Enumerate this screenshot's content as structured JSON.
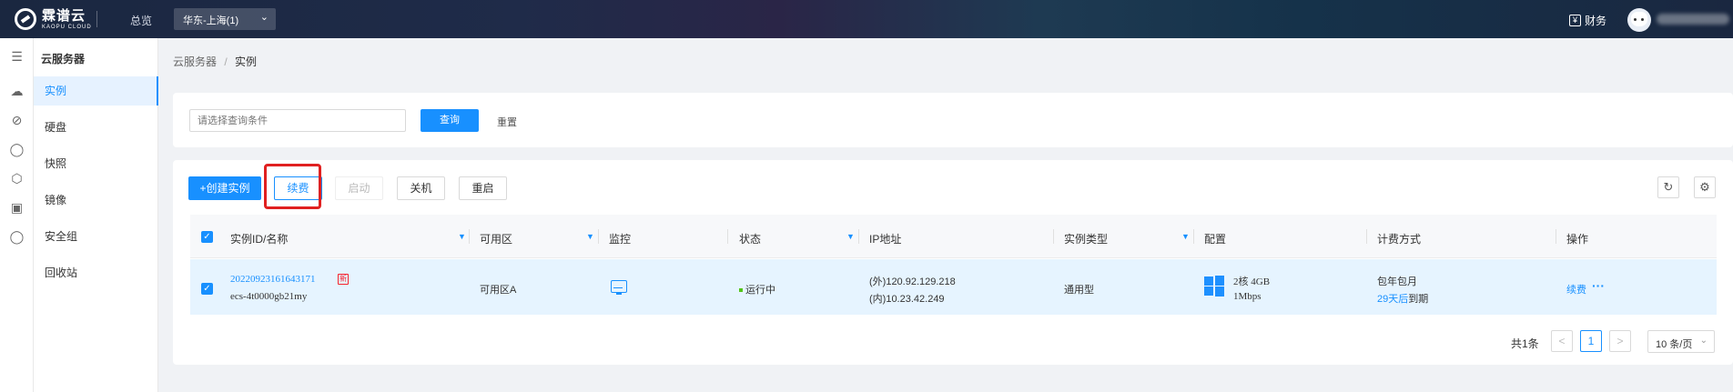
{
  "topbar": {
    "logo_cn": "霖谱云",
    "logo_en": "KAOPU CLOUD",
    "overview": "总览",
    "region": "华东-上海(1)",
    "finance": "财务",
    "yen": "¥"
  },
  "sidebar": {
    "title": "云服务器",
    "items": [
      {
        "label": "实例",
        "active": true
      },
      {
        "label": "硬盘"
      },
      {
        "label": "快照"
      },
      {
        "label": "镜像"
      },
      {
        "label": "安全组"
      },
      {
        "label": "回收站"
      }
    ]
  },
  "breadcrumb": {
    "parent": "云服务器",
    "sep": "/",
    "current": "实例"
  },
  "search": {
    "placeholder": "请选择查询条件",
    "query_button": "查询",
    "reset_button": "重置"
  },
  "toolbar": {
    "create": "+创建实例",
    "renew": "续费",
    "start": "启动",
    "shutdown": "关机",
    "restart": "重启",
    "refresh_icon": "refresh-icon",
    "settings_icon": "settings-icon"
  },
  "table": {
    "headers": [
      "实例ID/名称",
      "可用区",
      "监控",
      "状态",
      "IP地址",
      "实例类型",
      "配置",
      "计费方式",
      "操作"
    ],
    "rows": [
      {
        "instance_id": "20220923161643171",
        "name": "ecs-4t0000gb21my",
        "new_badge": "新",
        "zone": "可用区A",
        "status": "运行中",
        "ip_public": "(外)120.92.129.218",
        "ip_private": "(内)10.23.42.249",
        "type": "通用型",
        "config_cpu_mem": "2核 4GB",
        "config_bw": "1Mbps",
        "billing": "包年包月",
        "expire_days": "29天后",
        "expire_suffix": "到期",
        "action_renew": "续费",
        "action_more": "···"
      }
    ]
  },
  "pagination": {
    "total": "共1条",
    "prev": "<",
    "page": "1",
    "next": ">",
    "page_size": "10 条/页"
  },
  "colors": {
    "accent": "#1890ff",
    "highlight": "#e02020",
    "status_running": "#52c41a"
  }
}
